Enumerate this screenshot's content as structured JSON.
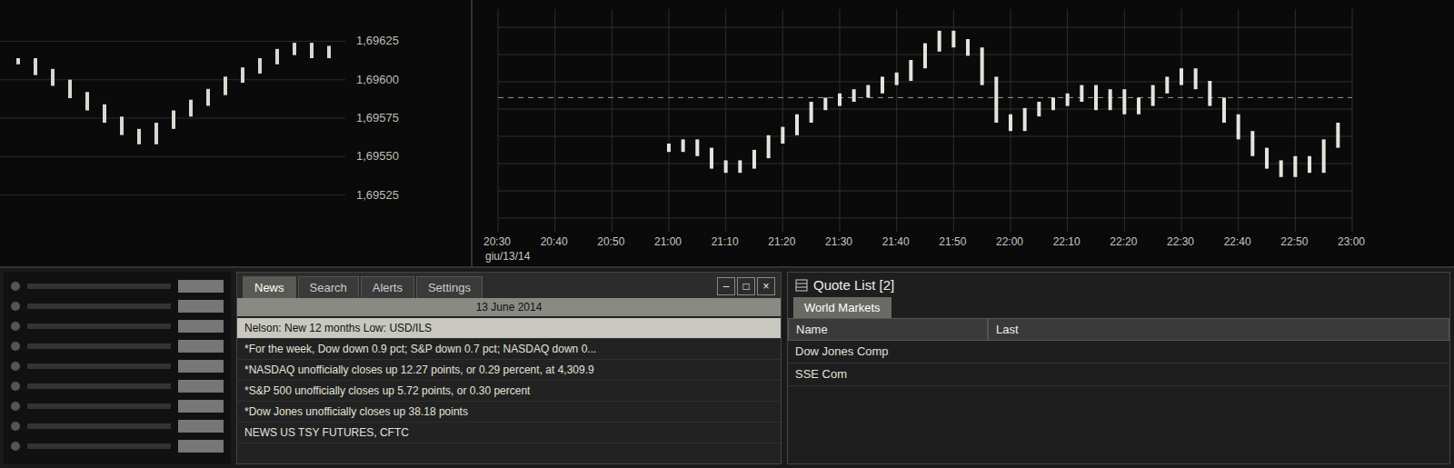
{
  "mini_chart": {
    "y_ticks": [
      "1,69625",
      "1,69600",
      "1,69575",
      "1,69550",
      "1,69525"
    ],
    "values": [
      1.69612,
      1.69605,
      1.69598,
      1.6959,
      1.69582,
      1.69574,
      1.69566,
      1.6956,
      1.6957,
      1.69578,
      1.69585,
      1.69592,
      1.696,
      1.69606,
      1.69612,
      1.69618,
      1.69622,
      1.69616,
      1.6962
    ]
  },
  "main_chart": {
    "date": "giu/13/14",
    "x_ticks": [
      "20:30",
      "20:40",
      "20:50",
      "21:00",
      "21:10",
      "21:20",
      "21:30",
      "21:40",
      "21:50",
      "22:00",
      "22:10",
      "22:20",
      "22:30",
      "22:40",
      "22:50",
      "23:00"
    ],
    "values": [
      38,
      40,
      36,
      30,
      28,
      30,
      35,
      42,
      46,
      52,
      58,
      60,
      62,
      64,
      66,
      70,
      72,
      78,
      86,
      92,
      88,
      84,
      70,
      52,
      48,
      55,
      58,
      60,
      62,
      66,
      58,
      64,
      56,
      60,
      66,
      70,
      74,
      68,
      60,
      52,
      44,
      36,
      30,
      26,
      32,
      28,
      40,
      48
    ],
    "reference": 62
  },
  "news": {
    "tabs": [
      {
        "label": "News",
        "selected": true
      },
      {
        "label": "Search",
        "selected": false
      },
      {
        "label": "Alerts",
        "selected": false
      },
      {
        "label": "Settings",
        "selected": false
      }
    ],
    "controls": [
      "–",
      "□",
      "×"
    ],
    "date": "13 June 2014",
    "rows": [
      {
        "headline": "Nelson: New 12 months Low: USD/ILS",
        "selected": true
      },
      {
        "headline": "*For the week, Dow down 0.9 pct; S&P down 0.7 pct; NASDAQ down 0...",
        "selected": false
      },
      {
        "headline": "*NASDAQ unofficially closes up 12.27 points, or 0.29 percent, at 4,309.9",
        "selected": false
      },
      {
        "headline": "*S&P 500 unofficially closes up 5.72 points, or 0.30 percent",
        "selected": false
      },
      {
        "headline": "*Dow Jones unofficially closes up 38.18 points",
        "selected": false
      },
      {
        "headline": "NEWS US TSY FUTURES, CFTC",
        "selected": false
      }
    ]
  },
  "quote_list": {
    "title": "Quote List [2]",
    "tab": "World Markets",
    "columns": [
      "Name",
      "Last"
    ],
    "rows": [
      {
        "name": "Dow Jones Comp"
      },
      {
        "name": "SSE Com"
      }
    ]
  }
}
